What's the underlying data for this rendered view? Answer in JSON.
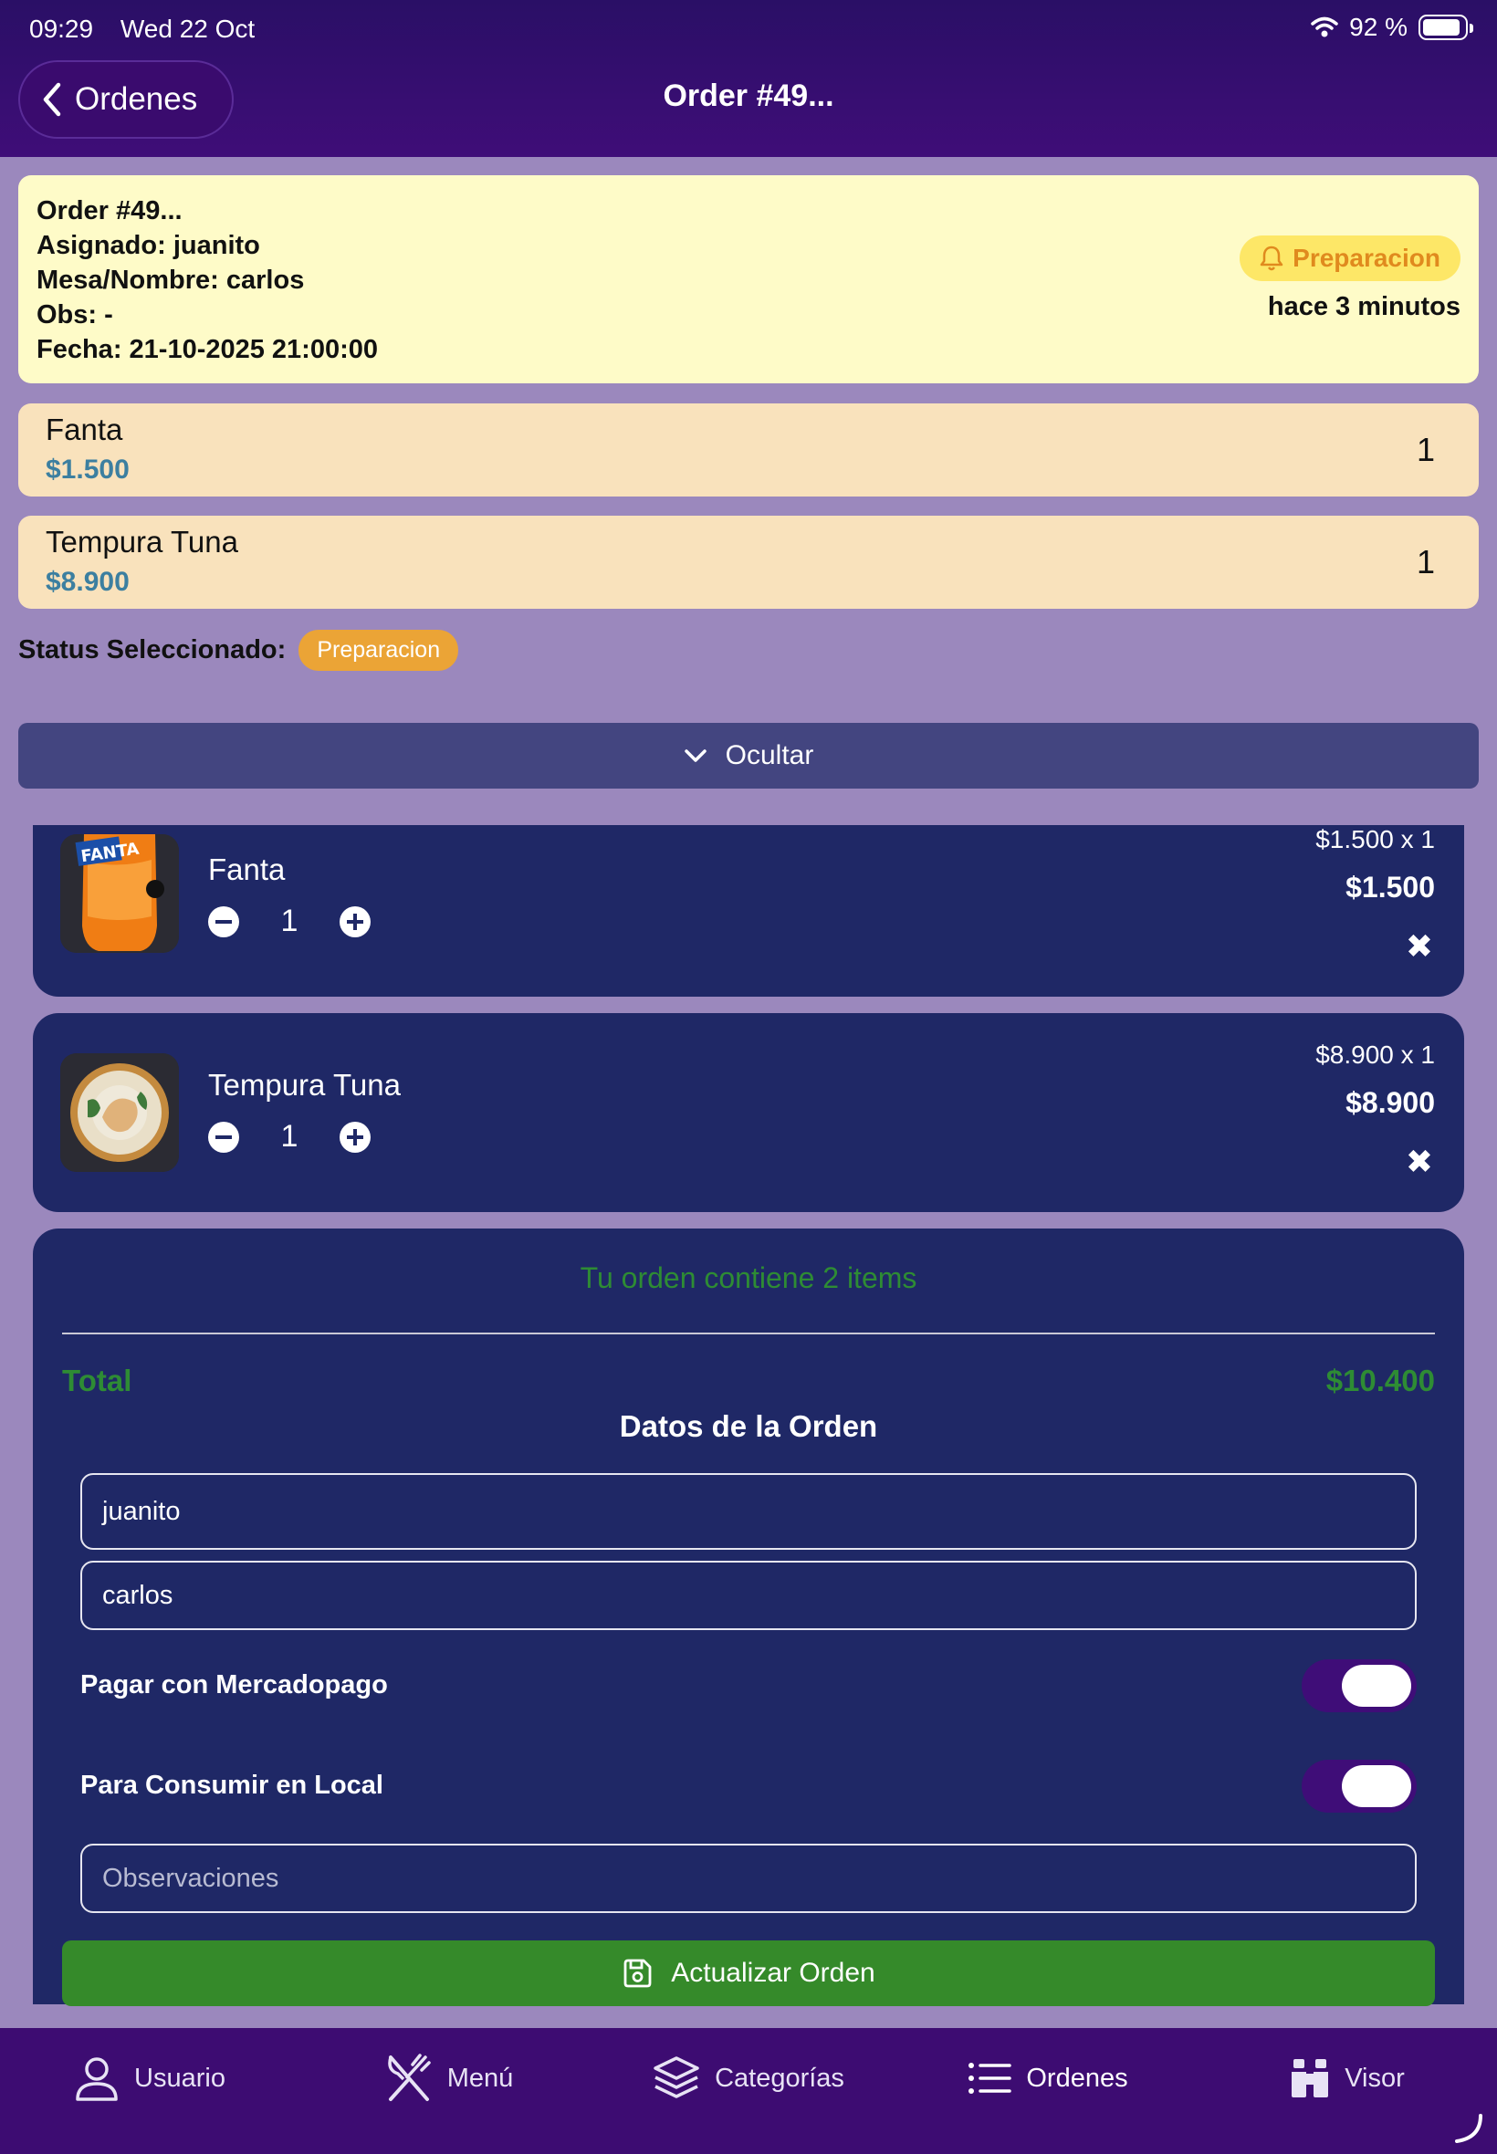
{
  "status_bar": {
    "time": "09:29",
    "date": "Wed 22 Oct",
    "battery": "92 %",
    "battery_level": 0.92
  },
  "nav": {
    "back_label": "Ordenes",
    "title": "Order #49..."
  },
  "order_info": {
    "id_line": "Order #49...",
    "assigned_line": "Asignado: juanito",
    "table_line": "Mesa/Nombre: carlos",
    "obs_line": "Obs:  -",
    "date_line": "Fecha: 21-10-2025 21:00:00",
    "status": "Preparacion",
    "ago": "hace 3 minutos"
  },
  "order_items": [
    {
      "name": "Fanta",
      "price": "$1.500",
      "qty": "1"
    },
    {
      "name": "Tempura Tuna",
      "price": "$8.900",
      "qty": "1"
    }
  ],
  "status_selected": {
    "label": "Status Seleccionado:",
    "value": "Preparacion"
  },
  "hide_button": "Ocultar",
  "cart": [
    {
      "name": "Fanta",
      "qty": "1",
      "unit": "$1.500 x 1",
      "total": "$1.500",
      "image": "fanta-bottle"
    },
    {
      "name": "Tempura Tuna",
      "qty": "1",
      "unit": "$8.900 x 1",
      "total": "$8.900",
      "image": "sushi-roll"
    }
  ],
  "summary": {
    "contains": "Tu orden contiene 2 items",
    "total_label": "Total",
    "total_value": "$10.400",
    "data_title": "Datos de la Orden",
    "assigned_value": "juanito",
    "table_value": "carlos",
    "toggle_mp_label": "Pagar con Mercadopago",
    "toggle_mp_on": true,
    "toggle_local_label": "Para Consumir en Local",
    "toggle_local_on": true,
    "obs_placeholder": "Observaciones",
    "update_button": "Actualizar Orden"
  },
  "tabs": [
    {
      "label": "Usuario",
      "icon": "user-icon"
    },
    {
      "label": "Menú",
      "icon": "utensils-icon"
    },
    {
      "label": "Categorías",
      "icon": "layers-icon"
    },
    {
      "label": "Ordenes",
      "icon": "list-icon",
      "active": true
    },
    {
      "label": "Visor",
      "icon": "binoculars-icon"
    }
  ],
  "colors": {
    "accent": "#3f0d78",
    "panel": "#1f2866",
    "success": "#358a2a",
    "warning": "#eba436",
    "background": "#9b88bd"
  }
}
